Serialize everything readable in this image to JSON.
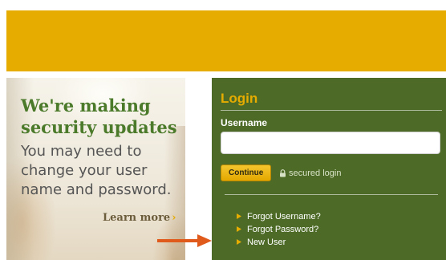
{
  "header": {
    "brand_color": "#e6ac00"
  },
  "promo": {
    "title": "We're making security updates",
    "body": "You may need to change your user name and password.",
    "link_label": "Learn more",
    "link_chevron": "›"
  },
  "login": {
    "heading": "Login",
    "username_label": "Username",
    "username_value": "",
    "continue_label": "Continue",
    "secured_label": "secured login",
    "links": [
      {
        "label": "Forgot Username?"
      },
      {
        "label": "Forgot Password?"
      },
      {
        "label": "New User"
      }
    ],
    "panel_color": "#4d6b27",
    "accent_color": "#e6ac00"
  },
  "annotation": {
    "arrow_color": "#e05a1c",
    "arrow_icon": "right-arrow-icon"
  }
}
